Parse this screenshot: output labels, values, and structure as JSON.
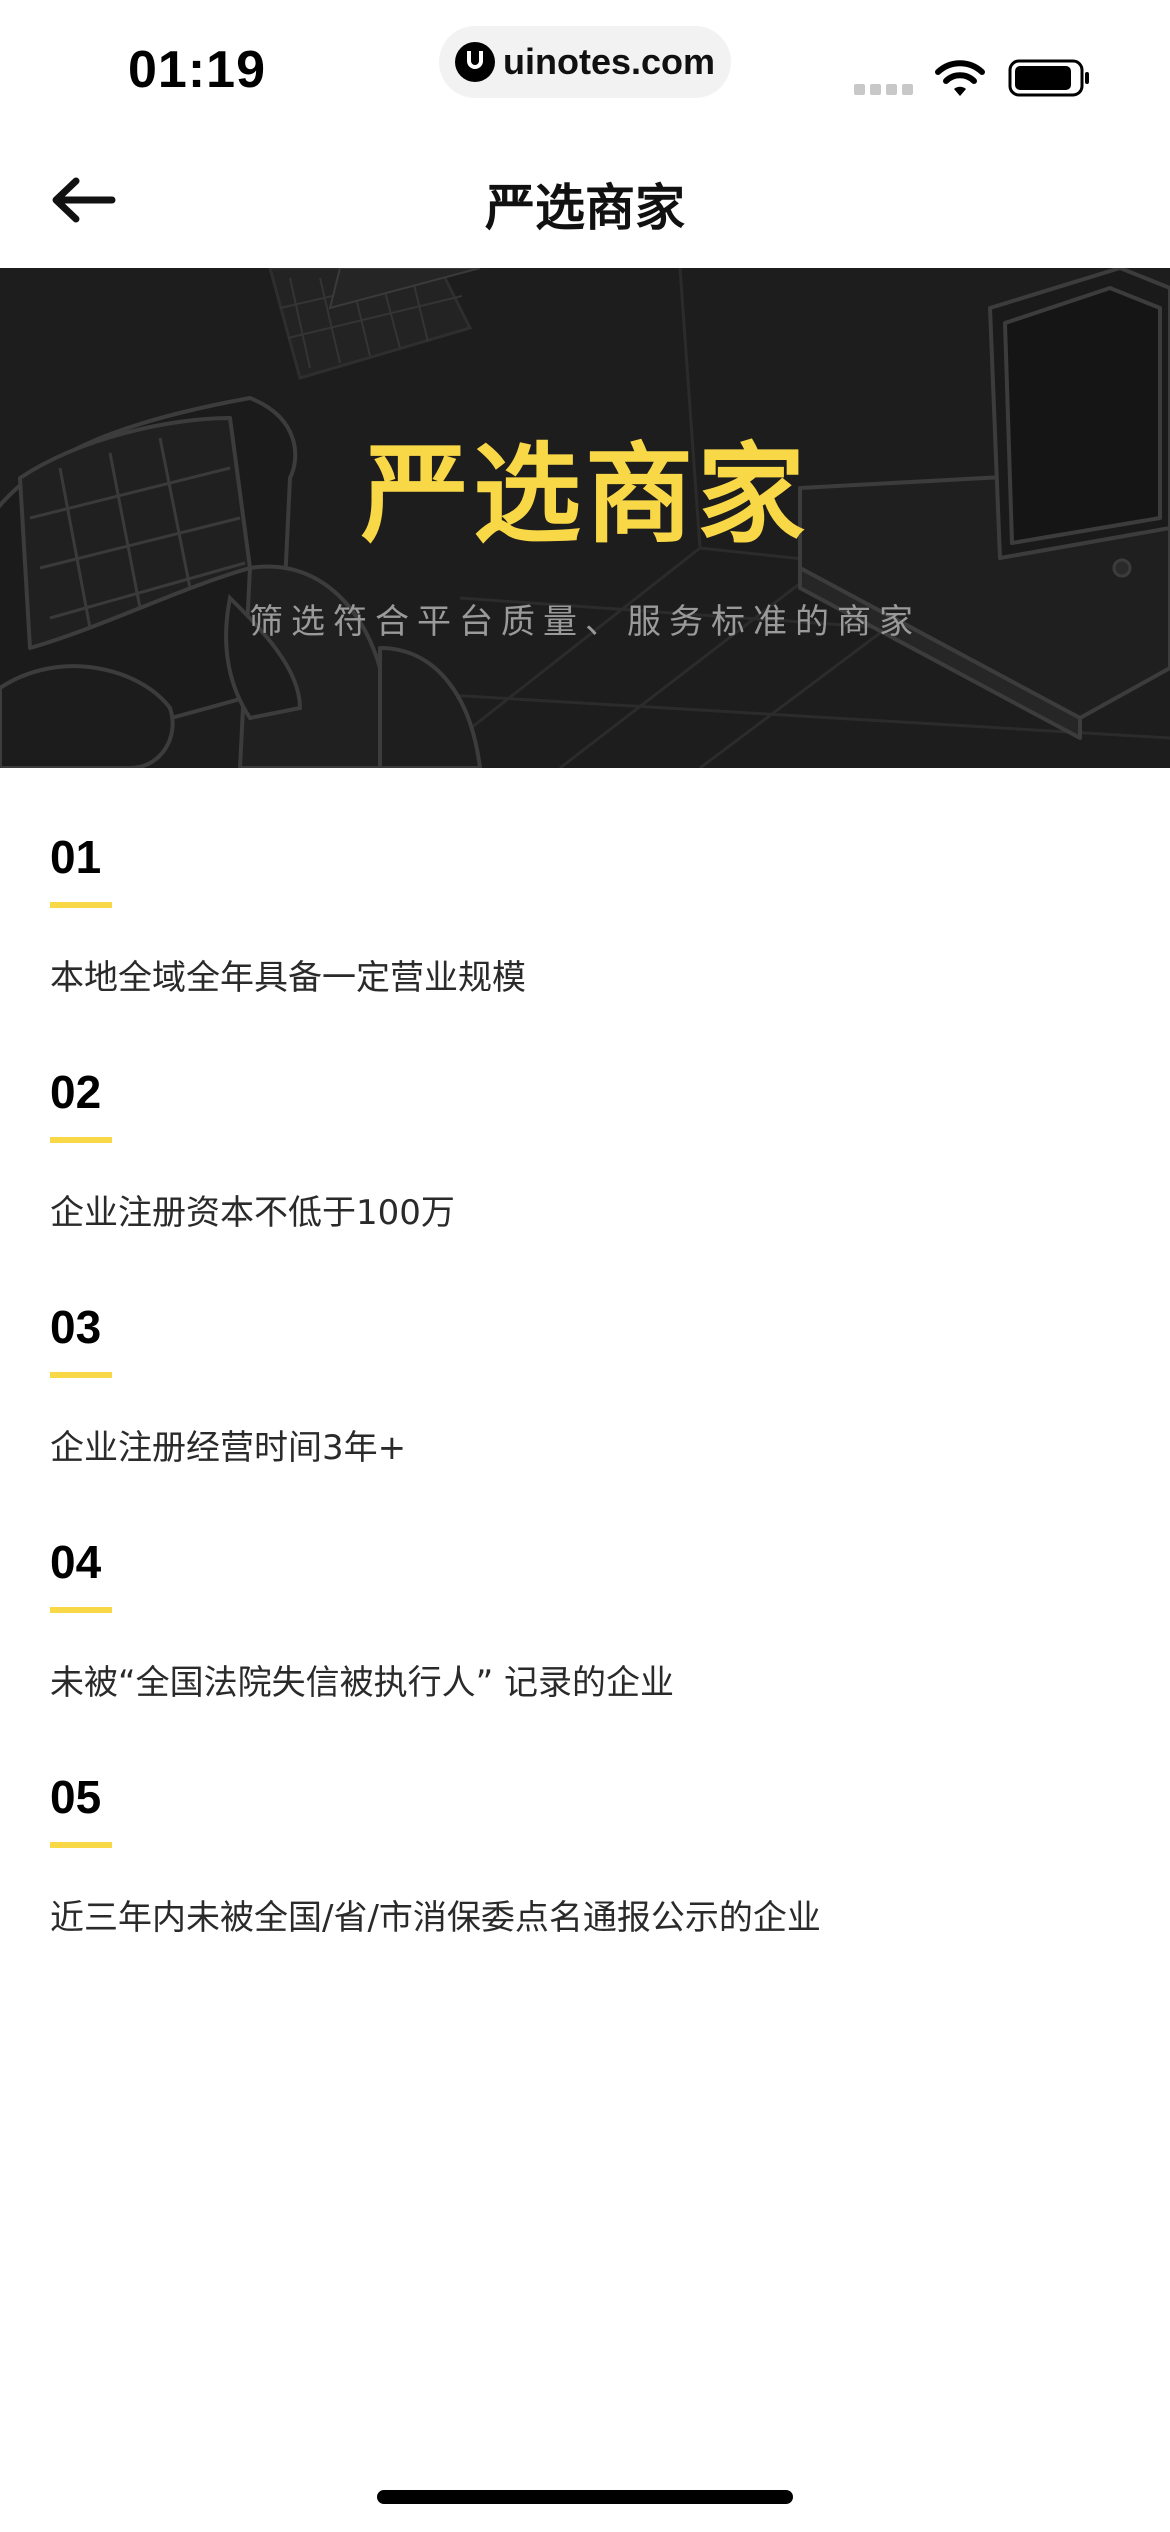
{
  "status_bar": {
    "time": "01:19",
    "url": "uinotes.com",
    "icons": [
      "signal-icon",
      "wifi-icon",
      "battery-icon"
    ]
  },
  "nav": {
    "back_icon": "arrow-left-icon",
    "title": "严选商家"
  },
  "hero": {
    "title": "严选商家",
    "subtitle": "筛选符合平台质量、服务标准的商家",
    "title_color": "#f8d847",
    "background_color": "#1d1d1d"
  },
  "criteria": [
    {
      "number": "01",
      "text": "本地全域全年具备一定营业规模"
    },
    {
      "number": "02",
      "text": "企业注册资本不低于100万"
    },
    {
      "number": "03",
      "text": "企业注册经营时间3年+"
    },
    {
      "number": "04",
      "text": "未被“全国法院失信被执行人” 记录的企业"
    },
    {
      "number": "05",
      "text": "近三年内未被全国/省/市消保委点名通报公示的企业"
    }
  ],
  "colors": {
    "accent": "#f8d847",
    "text_primary": "#1a1a1a"
  }
}
